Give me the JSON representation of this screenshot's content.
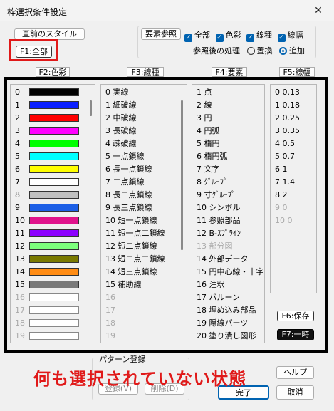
{
  "window": {
    "title": "枠選択条件設定",
    "close_glyph": "✕"
  },
  "toolbar": {
    "prev_style_label": "直前のスタイル",
    "f1_label": "F1:全部",
    "element_ref_label": "要素参照",
    "checks": [
      {
        "label": "全部",
        "checked": true
      },
      {
        "label": "色彩",
        "checked": true
      },
      {
        "label": "線種",
        "checked": true
      },
      {
        "label": "線幅",
        "checked": true
      }
    ],
    "after_ref_label": "参照後の処理",
    "radios": [
      {
        "label": "置換",
        "selected": false
      },
      {
        "label": "追加",
        "selected": true
      }
    ]
  },
  "tabs": {
    "color": "F2:色彩",
    "linetype": "F3:線種",
    "element": "F4:要素",
    "width": "F5:線幅"
  },
  "colors": {
    "rows": [
      {
        "num": "0",
        "color": "#000000",
        "dim": false
      },
      {
        "num": "1",
        "color": "#0a1fff",
        "dim": false
      },
      {
        "num": "2",
        "color": "#ff0000",
        "dim": false
      },
      {
        "num": "3",
        "color": "#ff00ff",
        "dim": false
      },
      {
        "num": "4",
        "color": "#00ff00",
        "dim": false
      },
      {
        "num": "5",
        "color": "#00ffff",
        "dim": false
      },
      {
        "num": "6",
        "color": "#ffff00",
        "dim": false
      },
      {
        "num": "7",
        "color": "#ffffff",
        "dim": false
      },
      {
        "num": "8",
        "color": "#c0c0c0",
        "dim": false
      },
      {
        "num": "9",
        "color": "#1c5fe6",
        "dim": false
      },
      {
        "num": "10",
        "color": "#e0148c",
        "dim": false
      },
      {
        "num": "11",
        "color": "#8c00ff",
        "dim": false
      },
      {
        "num": "12",
        "color": "#7cff7c",
        "dim": false
      },
      {
        "num": "13",
        "color": "#7a7a00",
        "dim": false
      },
      {
        "num": "14",
        "color": "#ff8c14",
        "dim": false
      },
      {
        "num": "15",
        "color": "#7a7a7a",
        "dim": false
      },
      {
        "num": "16",
        "color": "#ffffff",
        "dim": true
      },
      {
        "num": "17",
        "color": "#ffffff",
        "dim": true
      },
      {
        "num": "18",
        "color": "#ffffff",
        "dim": true
      },
      {
        "num": "19",
        "color": "#ffffff",
        "dim": true
      }
    ]
  },
  "linetypes": {
    "rows": [
      {
        "text": "0 実線",
        "dim": false
      },
      {
        "text": "1 細破線",
        "dim": false
      },
      {
        "text": "2 中破線",
        "dim": false
      },
      {
        "text": "3 長破線",
        "dim": false
      },
      {
        "text": "4 疎破線",
        "dim": false
      },
      {
        "text": "5 一点鎖線",
        "dim": false
      },
      {
        "text": "6 長一点鎖線",
        "dim": false
      },
      {
        "text": "7 二点鎖線",
        "dim": false
      },
      {
        "text": "8 長二点鎖線",
        "dim": false
      },
      {
        "text": "9 長三点鎖線",
        "dim": false
      },
      {
        "text": "10 短一点鎖線",
        "dim": false
      },
      {
        "text": "11 短一点二鎖線",
        "dim": false
      },
      {
        "text": "12 短二点鎖線",
        "dim": false
      },
      {
        "text": "13 短二点二鎖線",
        "dim": false
      },
      {
        "text": "14 短三点鎖線",
        "dim": false
      },
      {
        "text": "15 補助線",
        "dim": false
      },
      {
        "text": "16",
        "dim": true
      },
      {
        "text": "17",
        "dim": true
      },
      {
        "text": "18",
        "dim": true
      },
      {
        "text": "19",
        "dim": true
      }
    ]
  },
  "elements": {
    "rows": [
      {
        "text": "1 点",
        "dim": false
      },
      {
        "text": "2 線",
        "dim": false
      },
      {
        "text": "3 円",
        "dim": false
      },
      {
        "text": "4 円弧",
        "dim": false
      },
      {
        "text": "5 楕円",
        "dim": false
      },
      {
        "text": "6 楕円弧",
        "dim": false
      },
      {
        "text": "7 文字",
        "dim": false
      },
      {
        "text": "8 ｸﾞﾙｰﾌﾟ",
        "dim": false
      },
      {
        "text": "9 寸ｸﾞﾙｰﾌﾟ",
        "dim": false
      },
      {
        "text": "10 シンボル",
        "dim": false
      },
      {
        "text": "11 参照部品",
        "dim": false
      },
      {
        "text": "12 B-ｽﾌﾟﾗｲﾝ",
        "dim": false
      },
      {
        "text": "13 部分図",
        "dim": true
      },
      {
        "text": "14 外部データ",
        "dim": false
      },
      {
        "text": "15 円中心線・十字",
        "dim": false
      },
      {
        "text": "16 注釈",
        "dim": false
      },
      {
        "text": "17 バルーン",
        "dim": false
      },
      {
        "text": "18 埋め込み部品",
        "dim": false
      },
      {
        "text": "19 隠線パーツ",
        "dim": false
      },
      {
        "text": "20 塗り潰し図形",
        "dim": false
      }
    ]
  },
  "widths": {
    "rows": [
      {
        "text": "0  0.13",
        "dim": false
      },
      {
        "text": "1  0.18",
        "dim": false
      },
      {
        "text": "2  0.25",
        "dim": false
      },
      {
        "text": "3  0.35",
        "dim": false
      },
      {
        "text": "4  0.5",
        "dim": false
      },
      {
        "text": "5  0.7",
        "dim": false
      },
      {
        "text": "6  1",
        "dim": false
      },
      {
        "text": "7  1.4",
        "dim": false
      },
      {
        "text": "8  2",
        "dim": false
      },
      {
        "text": "9  0",
        "dim": true
      },
      {
        "text": "10 0",
        "dim": true
      }
    ]
  },
  "side_buttons": {
    "save_label": "F6:保存",
    "temp_label": "F7:一時"
  },
  "footer": {
    "pattern_label": "パターン登録",
    "register_label": "登録(V)",
    "delete_label": "削除(D)",
    "help_label": "ヘルプ",
    "ok_label": "完了",
    "cancel_label": "取消"
  },
  "annotation": {
    "text": "何も選択されていない状態",
    "color": "#e01919"
  }
}
